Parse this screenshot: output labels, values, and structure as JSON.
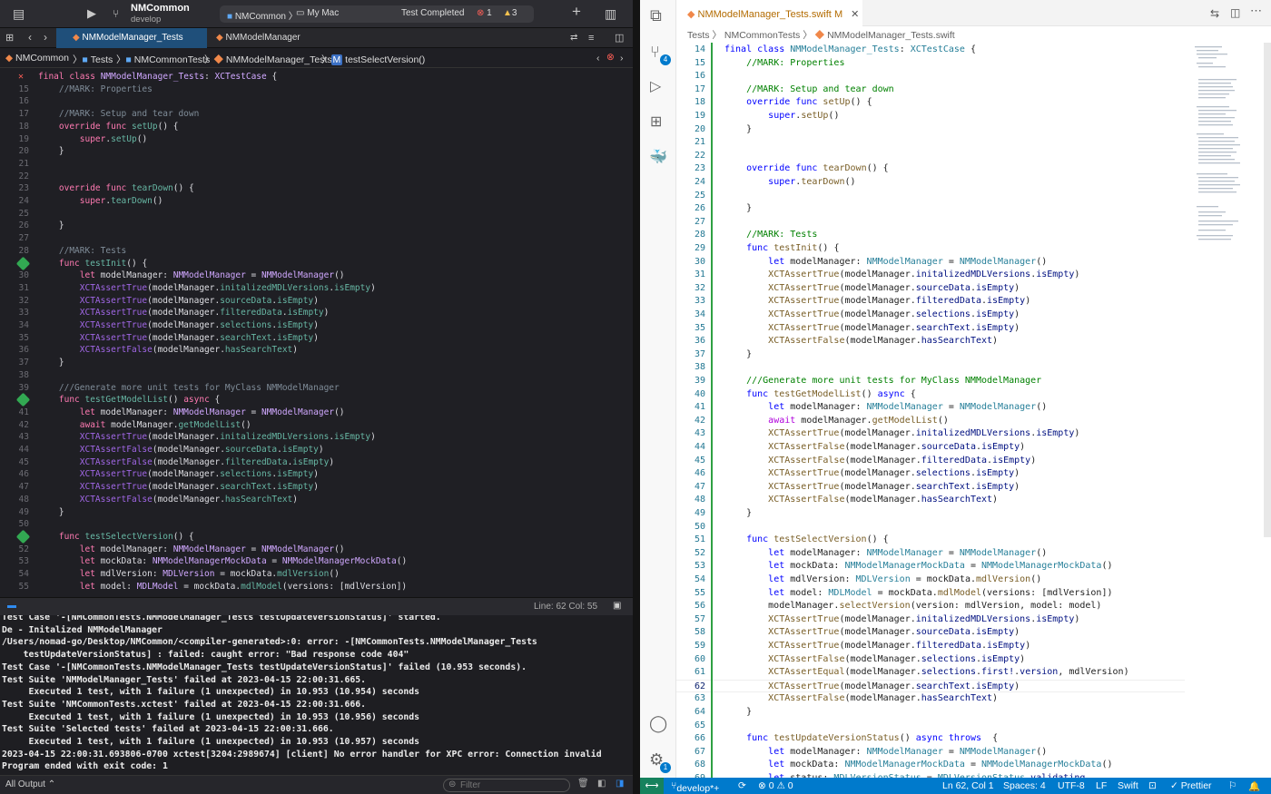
{
  "xcode": {
    "project": "NMCommon",
    "branch": "develop",
    "scheme": "NMCommon",
    "destination": "My Mac",
    "build_status": "Test Completed",
    "errors": "1",
    "warnings": "3",
    "tabs": [
      "NMModelManager_Tests",
      "NMModelManager"
    ],
    "breadcrumb": [
      "NMCommon",
      "Tests",
      "NMCommonTests",
      "NMModelManager_Tests",
      "testSelectVersion()"
    ],
    "status": "Line: 62  Col: 55",
    "filter_placeholder": "Filter",
    "output_selector": "All Output",
    "console": [
      "Test Case '-[NMCommonTests.NMModelManager_Tests testUpdateVersionStatus]' started.",
      "De - Initalized NMModelManager",
      "/Users/nomad-go/Desktop/NMCommon/<compiler-generated>:0: error: -[NMCommonTests.NMModelManager_Tests",
      "    testUpdateVersionStatus] : failed: caught error: \"Bad response code 404\"",
      "Test Case '-[NMCommonTests.NMModelManager_Tests testUpdateVersionStatus]' failed (10.953 seconds).",
      "Test Suite 'NMModelManager_Tests' failed at 2023-04-15 22:00:31.665.",
      "     Executed 1 test, with 1 failure (1 unexpected) in 10.953 (10.954) seconds",
      "Test Suite 'NMCommonTests.xctest' failed at 2023-04-15 22:00:31.666.",
      "     Executed 1 test, with 1 failure (1 unexpected) in 10.953 (10.956) seconds",
      "Test Suite 'Selected tests' failed at 2023-04-15 22:00:31.666.",
      "     Executed 1 test, with 1 failure (1 unexpected) in 10.953 (10.957) seconds",
      "2023-04-15 22:00:31.693806-0700 xctest[3204:2989674] [client] No error handler for XPC error: Connection invalid",
      "Program ended with exit code: 1"
    ]
  },
  "vscode": {
    "tab_label": "NMModelManager_Tests.swift",
    "tab_modified": "M",
    "breadcrumb": [
      "Tests",
      "NMCommonTests",
      "NMModelManager_Tests.swift"
    ],
    "scm_badge": "4",
    "settings_badge": "1",
    "status": {
      "branch": "develop*+",
      "problems": "⊗ 0 ⚠ 0",
      "position": "Ln 62, Col 1",
      "spaces": "Spaces: 4",
      "encoding": "UTF-8",
      "eol": "LF",
      "language": "Swift",
      "prettier": "✓ Prettier"
    }
  },
  "colors": {
    "xcode_bg": "#1f1f24",
    "vscode_status": "#007acc",
    "vscode_bg": "#ffffff"
  }
}
